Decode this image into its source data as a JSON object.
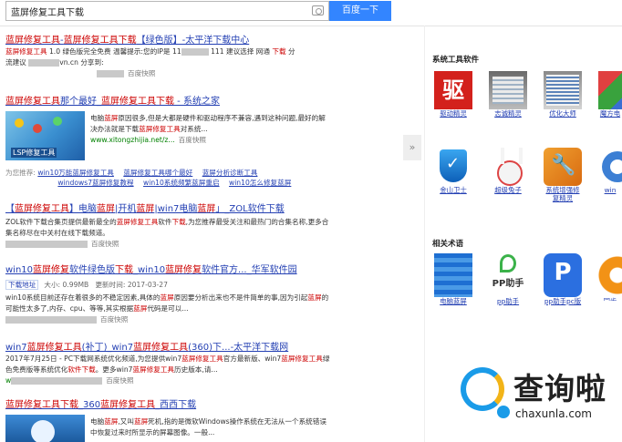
{
  "search": {
    "query": "蓝屏修复工具下载",
    "button_label": "百度一下"
  },
  "results": {
    "r1": {
      "title_a": "蓝屏修复工具",
      "title_b": "-",
      "title_c": "蓝屏修复工具下载",
      "title_d": "【绿色版】-太平洋下载中心",
      "abs_a": "蓝屏修复工具",
      "abs_b": " 1.0 绿色版完全免费 温馨提示:您的IP是 11",
      "abs_c": " 111 建议选择 网通 ",
      "abs_d": "下载",
      "abs_e": " 分",
      "abs_f": "流建议 ",
      "abs_g": "vn.cn 分享到:",
      "snapshot": "百度快照"
    },
    "r2": {
      "title_a": "蓝屏修复工具",
      "title_b": "那个最好_",
      "title_c": "蓝屏修复工具下载",
      "title_d": " - 系统之家",
      "abs_a": "电脑",
      "abs_b": "蓝屏",
      "abs_c": "原因很多,但是大都是硬件和驱动程序不兼容,遇到这种问题,最好的解决办法就是下载",
      "abs_d": "蓝屏修复工具",
      "abs_e": "对系统...",
      "url": "www.xitongzhijia.net/z...",
      "snapshot": "百度快照",
      "thumb_text": "LSP修复工具"
    },
    "hints": {
      "label": "为您推荐:",
      "links": [
        "win10万能蓝屏修复工具",
        "蓝屏修复工具哪个最好",
        "蓝屏分析诊断工具",
        "windows7蓝屏修复教程",
        "win10系统频繁蓝屏重启",
        "win10怎么修复蓝屏"
      ]
    },
    "r3": {
      "title_a": "【",
      "title_b": "蓝屏修复工具",
      "title_c": "】电脑",
      "title_d": "蓝屏",
      "title_e": "|开机",
      "title_f": "蓝屏",
      "title_g": "|win7电脑",
      "title_h": "蓝屏",
      "title_i": "」_ZOL软件下载",
      "abs_a": "ZOL软件下载合集页提供最新最全的",
      "abs_b": "蓝屏修复工具",
      "abs_c": "软件",
      "abs_d": "下载",
      "abs_e": ",为您推荐最受关注和最热门的合集名称,更多合集名称尽在中关村在线下载频道。",
      "snapshot": "百度快照"
    },
    "r4": {
      "title_a": "win10",
      "title_b": "蓝屏修复",
      "title_c": "软件绿色版",
      "title_d": "下载",
      "title_e": "_win10",
      "title_f": "蓝屏修复",
      "title_g": "软件官方..._华军软件园",
      "dl_label": "下载地址",
      "size": "大小: 0.99MB",
      "date": "更新时间: 2017-03-27",
      "abs_a": "win10系统目前还存在着很多的不稳定因素,具体的",
      "abs_b": "蓝屏",
      "abs_c": "原因要分析出来也不是件简单的事,因为引起",
      "abs_d": "蓝屏",
      "abs_e": "的可能性太多了,内存、cpu、等等,其实根据",
      "abs_f": "蓝屏",
      "abs_g": "代码是可以...",
      "snapshot": "百度快照"
    },
    "r5": {
      "title_a": "win7",
      "title_b": "蓝屏修复工具",
      "title_c": "(补丁)_win7",
      "title_d": "蓝屏修复工具",
      "title_e": "(360)下...-太平洋下载网",
      "abs_a": "2017年7月25日 - PC下载网系统优化频道,为您提供win7",
      "abs_b": "蓝屏修复工具",
      "abs_c": "官方最新版、win7",
      "abs_d": "蓝屏修复工具",
      "abs_e": "绿色免费版等系统优化",
      "abs_f": "软件下载",
      "abs_g": "。更多win7",
      "abs_h": "蓝屏修复工具",
      "abs_i": "历史版本,请...",
      "url": "w",
      "snapshot": "百度快照"
    },
    "r6": {
      "title_a": "蓝屏修复工具下载",
      "title_b": "_360",
      "title_c": "蓝屏修复工具",
      "title_d": "_西西下载",
      "abs_a": "电脑",
      "abs_b": "蓝屏",
      "abs_c": ",又叫",
      "abs_d": "蓝屏",
      "abs_e": "死机,指的是微软Windows操作系统在无法从一个系统错误中恢复过来时所显示的屏幕图像。一般..."
    }
  },
  "right_panel": {
    "section1_title": "系统工具软件",
    "section2_title": "相关术语",
    "tiles1": [
      "驱动精灵",
      "志诚精灵",
      "优化大师",
      "魔方电"
    ],
    "tiles1_icon_text": "驱",
    "tiles2": [
      "金山卫士",
      "超级兔子",
      "系统增强修复精灵",
      "win"
    ],
    "tiles3": [
      "电脑蓝屏",
      "pp助手",
      "pp助手pc版",
      "同步"
    ],
    "pp_icon_text": "PP助手",
    "ppbox_icon_text": "P",
    "collapse_icon": "»"
  },
  "watermark": {
    "chinese": "查询啦",
    "domain": "chaxunla.com"
  }
}
